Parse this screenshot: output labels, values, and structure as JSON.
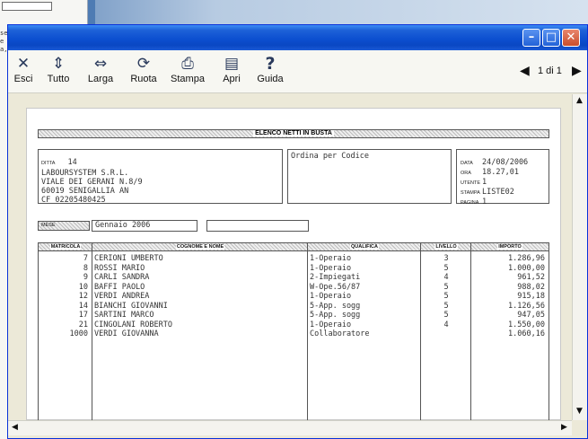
{
  "background": {
    "truncated_lines": [
      "se",
      "e",
      "a,"
    ]
  },
  "window": {
    "controls": {
      "minimize": "–",
      "maximize": "□",
      "close": "✕"
    }
  },
  "toolbar": {
    "items": [
      {
        "label": "Esci",
        "icon": "close-icon",
        "glyph": "✕"
      },
      {
        "label": "Tutto",
        "icon": "fit-page-icon",
        "glyph": "⇕"
      },
      {
        "label": "Larga",
        "icon": "fit-width-icon",
        "glyph": "⇔"
      },
      {
        "label": "Ruota",
        "icon": "rotate-icon",
        "glyph": "⟳"
      },
      {
        "label": "Stampa",
        "icon": "printer-icon",
        "glyph": "⎙"
      },
      {
        "label": "Apri",
        "icon": "open-file-icon",
        "glyph": "▤"
      },
      {
        "label": "Guida",
        "icon": "help-icon",
        "glyph": "?"
      }
    ],
    "pager": {
      "text": "1 di 1",
      "prev": "◀",
      "next": "▶"
    }
  },
  "report": {
    "title": "ELENCO NETTI IN BUSTA",
    "company": {
      "ditta_label": "DITTA",
      "ditta_value": "14",
      "lines": [
        "LABOURSYSTEM S.R.L.",
        "VIALE DEI GERANI N.8/9",
        "60019 SENIGALLIA AN",
        "CF 02205480425"
      ]
    },
    "ordering": "Ordina per Codice",
    "meta": [
      {
        "label": "DATA",
        "value": "24/08/2006"
      },
      {
        "label": "ORA",
        "value": "18.27,01"
      },
      {
        "label": "UTENTE",
        "value": "1"
      },
      {
        "label": "STAMPA",
        "value": "LISTE02"
      },
      {
        "label": "PAGINA",
        "value": "1"
      }
    ],
    "mese_label": "MESE",
    "mese_value": "Gennaio  2006",
    "columns": {
      "matricola": "MATRICOLA",
      "nome": "COGNOME E NOME",
      "qualifica": "QUALIFICA",
      "livello": "LIVELLO",
      "importo": "IMPORTO"
    },
    "rows": [
      {
        "matricola": "7",
        "nome": "CERIONI UMBERTO",
        "qualifica": "1-Operaio",
        "livello": "3",
        "importo": "1.286,96"
      },
      {
        "matricola": "8",
        "nome": "ROSSI MARIO",
        "qualifica": "1-Operaio",
        "livello": "5",
        "importo": "1.000,00"
      },
      {
        "matricola": "9",
        "nome": "CARLI SANDRA",
        "qualifica": "2-Impiegati",
        "livello": "4",
        "importo": "961,52"
      },
      {
        "matricola": "10",
        "nome": "BAFFI PAOLO",
        "qualifica": "W-Ope.56/87",
        "livello": "5",
        "importo": "988,02"
      },
      {
        "matricola": "12",
        "nome": "VERDI ANDREA",
        "qualifica": "1-Operaio",
        "livello": "5",
        "importo": "915,18"
      },
      {
        "matricola": "14",
        "nome": "BIANCHI GIOVANNI",
        "qualifica": "5-App. sogg",
        "livello": "5",
        "importo": "1.126,56"
      },
      {
        "matricola": "17",
        "nome": "SARTINI MARCO",
        "qualifica": "5-App. sogg",
        "livello": "5",
        "importo": "947,05"
      },
      {
        "matricola": "21",
        "nome": "CINGOLANI ROBERTO",
        "qualifica": "1-Operaio",
        "livello": "4",
        "importo": "1.550,00"
      },
      {
        "matricola": "1000",
        "nome": "VERDI GIOVANNA",
        "qualifica": "Collaboratore",
        "livello": "",
        "importo": "1.060,16"
      }
    ]
  },
  "scrollbars": {
    "up": "▲",
    "down": "▼",
    "left": "◀",
    "right": "▶"
  }
}
